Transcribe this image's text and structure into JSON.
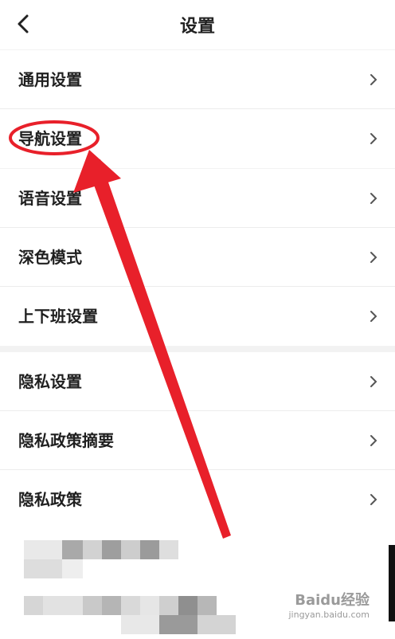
{
  "header": {
    "title": "设置",
    "back_icon": "chevron-left-icon"
  },
  "groups": [
    {
      "items": [
        {
          "label": "通用设置"
        },
        {
          "label": "导航设置"
        }
      ]
    },
    {
      "items": [
        {
          "label": "语音设置"
        },
        {
          "label": "深色模式"
        },
        {
          "label": "上下班设置"
        }
      ]
    },
    {
      "items": [
        {
          "label": "隐私设置"
        },
        {
          "label": "隐私政策摘要"
        },
        {
          "label": "隐私政策"
        }
      ]
    }
  ],
  "chevron_icon": "chevron-right-icon",
  "watermark": {
    "text": "Baidu经验",
    "sub": "jingyan.baidu.com"
  },
  "colors": {
    "annotation_red": "#e8202a",
    "header_bg": "#ffffff",
    "separator": "#f2f2f2"
  }
}
